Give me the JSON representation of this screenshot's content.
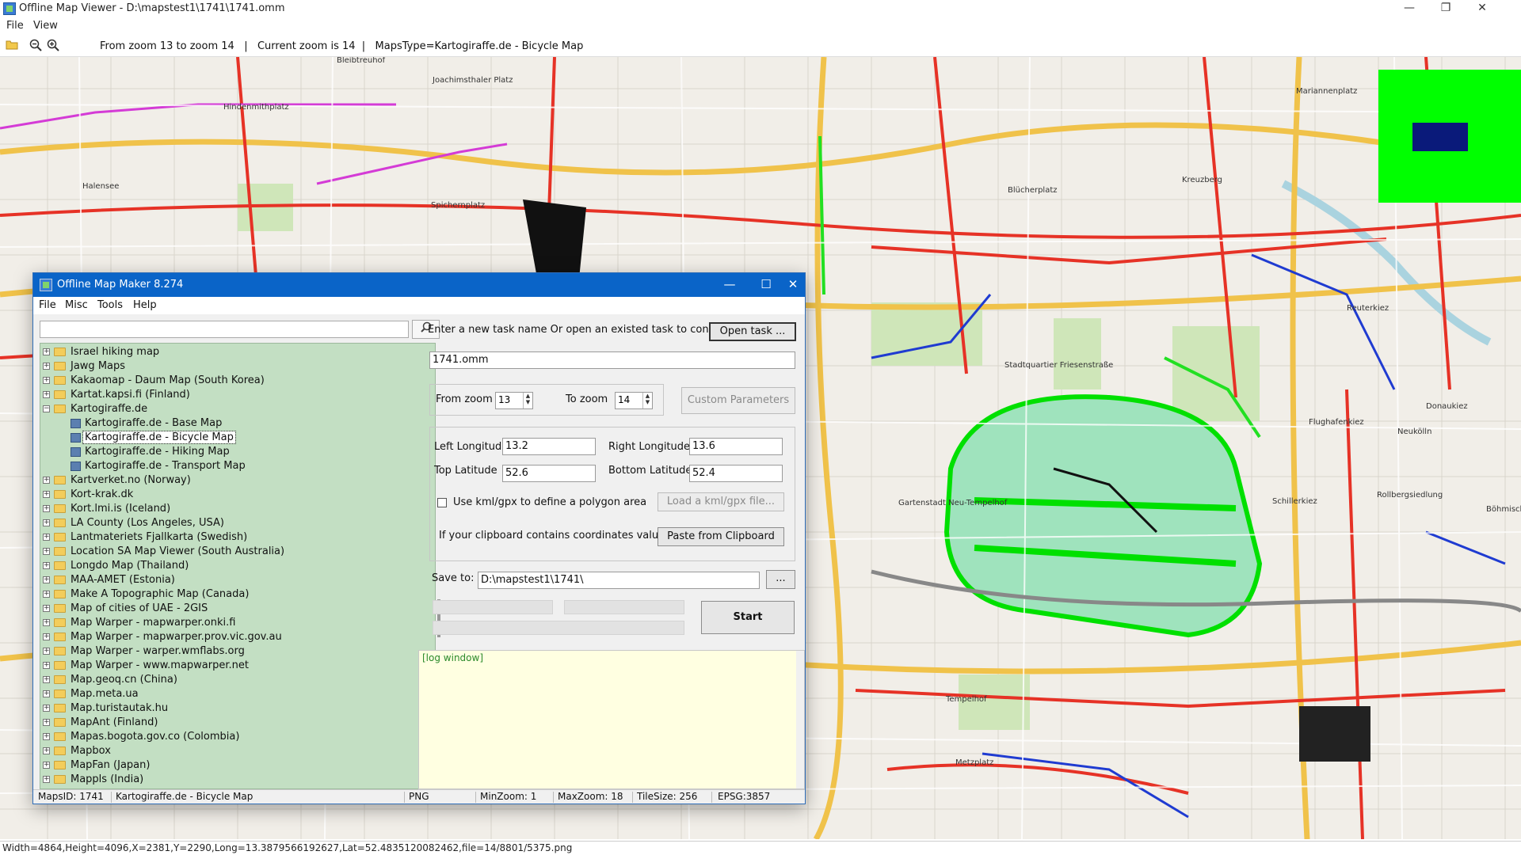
{
  "app": {
    "title": "Offline Map Viewer - D:\\mapstest1\\1741\\1741.omm",
    "menu": [
      "File",
      "View"
    ],
    "toolbar_info": "From zoom 13 to zoom 14   |   Current zoom is 14  |   MapsType=Kartogiraffe.de - Bicycle Map",
    "window_controls": {
      "minimize": "—",
      "maximize": "❐",
      "close": "✕"
    }
  },
  "map": {
    "labels": [
      "Bleibtreuhof",
      "Hindenmithplatz",
      "Joachimsthaler Platz",
      "Spichernplatz",
      "Halensee",
      "Blücherplatz",
      "Kreuzberg",
      "Mariannenplatz",
      "Stadtquartier Friesenstraße",
      "Reuterkiez",
      "Donaukiez",
      "Flughafenkiez",
      "Neukölln",
      "Schillerkiez",
      "Rollbergsiedlung",
      "Gartenstadt Neu-Tempelhof",
      "Tempelhof",
      "Metzplatz",
      "Böhmisches Richardk"
    ],
    "status": "Width=4864,Height=4096,X=2381,Y=2290,Long=13.3879566192627,Lat=52.4835120082462,file=14/8801/5375.png"
  },
  "dialog": {
    "title": "Offline Map Maker 8.274",
    "menu": [
      "File",
      "Misc",
      "Tools",
      "Help"
    ],
    "controls": {
      "minimize": "—",
      "maximize": "☐",
      "close": "✕"
    },
    "search_placeholder": "",
    "search_icon": "search-icon",
    "tree": [
      {
        "label": "Israel hiking map",
        "level": 0,
        "expanded": false
      },
      {
        "label": "Jawg Maps",
        "level": 0,
        "expanded": false
      },
      {
        "label": "Kakaomap - Daum Map (South Korea)",
        "level": 0,
        "expanded": false
      },
      {
        "label": "Kartat.kapsi.fi (Finland)",
        "level": 0,
        "expanded": false
      },
      {
        "label": "Kartogiraffe.de",
        "level": 0,
        "expanded": true
      },
      {
        "label": "Kartogiraffe.de - Base Map",
        "level": 1
      },
      {
        "label": "Kartogiraffe.de - Bicycle Map",
        "level": 1,
        "selected": true
      },
      {
        "label": "Kartogiraffe.de - Hiking Map",
        "level": 1
      },
      {
        "label": "Kartogiraffe.de - Transport Map",
        "level": 1
      },
      {
        "label": "Kartverket.no (Norway)",
        "level": 0,
        "expanded": false
      },
      {
        "label": "Kort-krak.dk",
        "level": 0,
        "expanded": false
      },
      {
        "label": "Kort.lmi.is (Iceland)",
        "level": 0,
        "expanded": false
      },
      {
        "label": "LA County (Los Angeles, USA)",
        "level": 0,
        "expanded": false
      },
      {
        "label": "Lantmateriets Fjallkarta (Swedish)",
        "level": 0,
        "expanded": false
      },
      {
        "label": "Location SA Map Viewer (South Australia)",
        "level": 0,
        "expanded": false
      },
      {
        "label": "Longdo Map (Thailand)",
        "level": 0,
        "expanded": false
      },
      {
        "label": "MAA-AMET (Estonia)",
        "level": 0,
        "expanded": false
      },
      {
        "label": "Make A Topographic Map (Canada)",
        "level": 0,
        "expanded": false
      },
      {
        "label": "Map of cities of UAE - 2GIS",
        "level": 0,
        "expanded": false
      },
      {
        "label": "Map Warper - mapwarper.onki.fi",
        "level": 0,
        "expanded": false
      },
      {
        "label": "Map Warper - mapwarper.prov.vic.gov.au",
        "level": 0,
        "expanded": false
      },
      {
        "label": "Map Warper - warper.wmflabs.org",
        "level": 0,
        "expanded": false
      },
      {
        "label": "Map Warper - www.mapwarper.net",
        "level": 0,
        "expanded": false
      },
      {
        "label": "Map.geoq.cn (China)",
        "level": 0,
        "expanded": false
      },
      {
        "label": "Map.meta.ua",
        "level": 0,
        "expanded": false
      },
      {
        "label": "Map.turistautak.hu",
        "level": 0,
        "expanded": false
      },
      {
        "label": "MapAnt (Finland)",
        "level": 0,
        "expanded": false
      },
      {
        "label": "Mapas.bogota.gov.co (Colombia)",
        "level": 0,
        "expanded": false
      },
      {
        "label": "Mapbox",
        "level": 0,
        "expanded": false
      },
      {
        "label": "MapFan (Japan)",
        "level": 0,
        "expanded": false
      },
      {
        "label": "Mappls (India)",
        "level": 0,
        "expanded": false
      }
    ],
    "task_prompt": "Enter a new task name Or open an existed task to continue:",
    "open_task_btn": "Open task ...",
    "task_name": "1741.omm",
    "from_zoom_label": "From zoom",
    "from_zoom": "13",
    "to_zoom_label": "To zoom",
    "to_zoom": "14",
    "custom_params_btn": "Custom Parameters",
    "left_lon_label": "Left Longitude",
    "left_lon": "13.2",
    "right_lon_label": "Right Longitude",
    "right_lon": "13.6",
    "top_lat_label": "Top Latitude",
    "top_lat": "52.6",
    "bottom_lat_label": "Bottom Latitude",
    "bottom_lat": "52.4",
    "kml_label": "Use kml/gpx to define a polygon area",
    "kml_btn": "Load a kml/gpx file...",
    "clipboard_label": "If your clipboard contains coordinates values:",
    "clipboard_btn": "Paste from Clipboard",
    "save_to_label": "Save to:",
    "save_to": "D:\\mapstest1\\1741\\",
    "browse_btn": "...",
    "start_btn": "Start",
    "log_label": "[log window]",
    "status": {
      "maps_id": "MapsID: 1741",
      "maps_name": "Kartogiraffe.de - Bicycle Map",
      "format": "PNG",
      "min_zoom": "MinZoom: 1",
      "max_zoom": "MaxZoom: 18",
      "tile_size": "TileSize: 256",
      "epsg": "EPSG:3857"
    }
  }
}
